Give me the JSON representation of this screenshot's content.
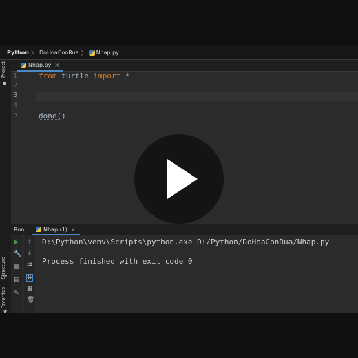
{
  "breadcrumb": {
    "root": "Python",
    "project": "DoHoaConRua",
    "file": "Nhap.py"
  },
  "left_strip": {
    "project": "Project",
    "structure": "Structure",
    "favorites": "Favorites"
  },
  "editor": {
    "tab": "Nhap.py",
    "close": "×",
    "line_numbers": [
      "1",
      "2",
      "3",
      "4",
      "5"
    ],
    "lines": [
      {
        "kw1": "from",
        "mid": " turtle ",
        "kw2": "import",
        "rest": " *"
      },
      "",
      "",
      "",
      "done()"
    ]
  },
  "run": {
    "label": "Run:",
    "tab": "Nhap (1)",
    "close": "×",
    "command": "D:\\Python\\venv\\Scripts\\python.exe D:/Python/DoHoaConRua/Nhap.py",
    "exit": "Process finished with exit code 0"
  },
  "colors": {
    "keyword": "#cc7832",
    "text": "#a9b7c6",
    "accent": "#4a88c7",
    "run": "#499c54"
  }
}
